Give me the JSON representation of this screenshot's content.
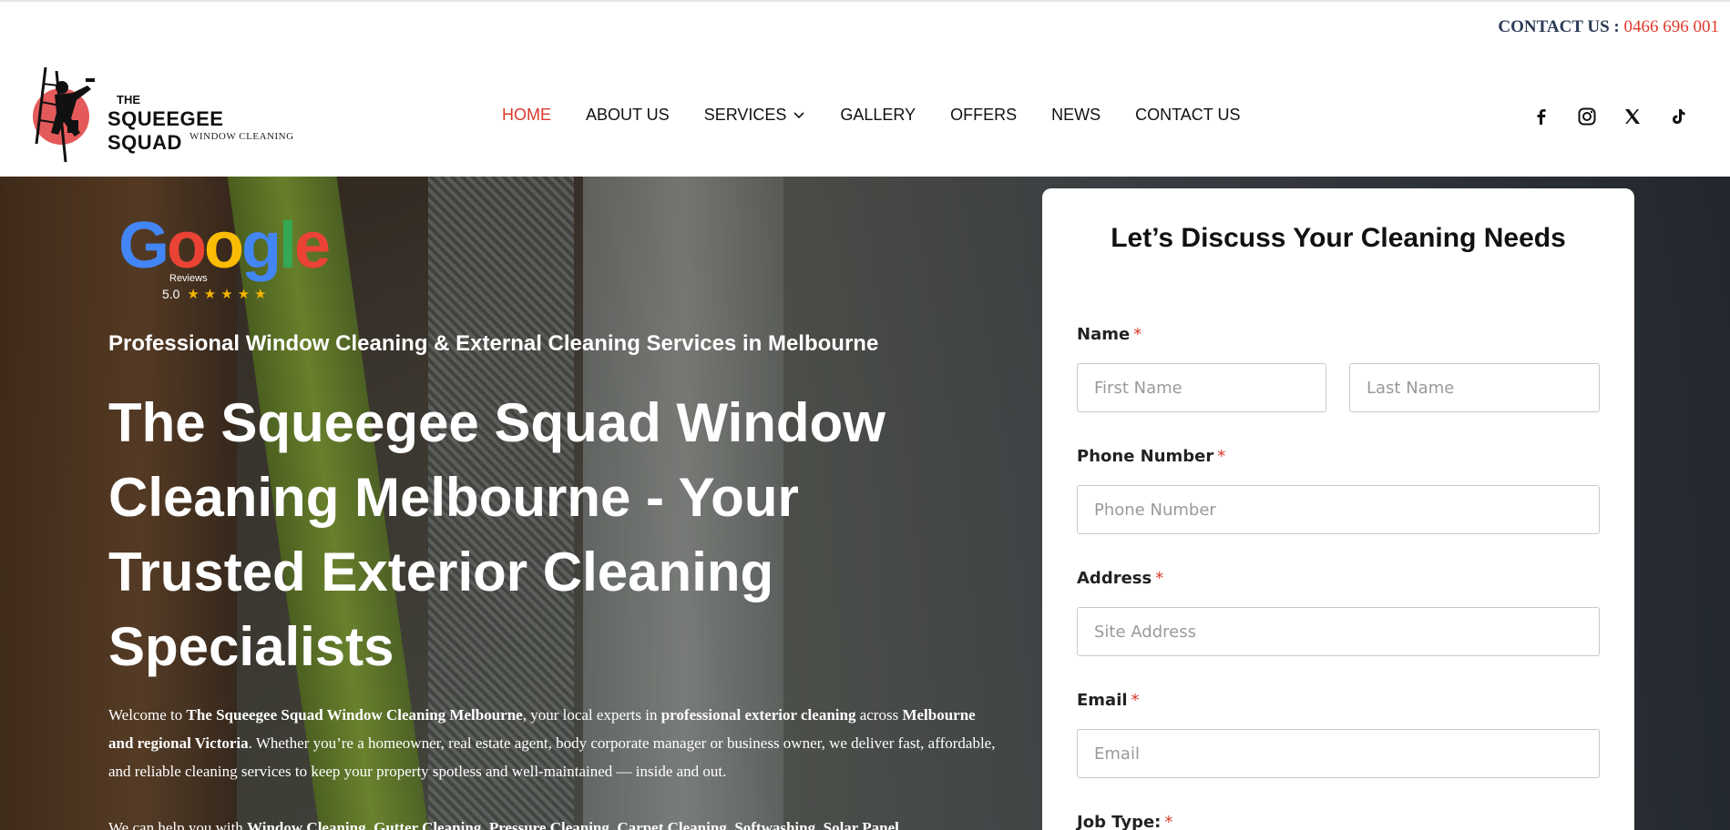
{
  "contact_bar": {
    "label": "CONTACT US :",
    "phone": "0466 696 001"
  },
  "logo": {
    "the": "THE",
    "brand": "SQUEEGEE SQUAD",
    "sub": "WINDOW CLEANING"
  },
  "nav": {
    "items": [
      {
        "label": "HOME",
        "active": true
      },
      {
        "label": "ABOUT US"
      },
      {
        "label": "SERVICES",
        "has_dropdown": true
      },
      {
        "label": "GALLERY"
      },
      {
        "label": "OFFERS"
      },
      {
        "label": "NEWS"
      },
      {
        "label": "CONTACT US"
      }
    ]
  },
  "social": [
    "facebook-icon",
    "instagram-icon",
    "x-icon",
    "tiktok-icon"
  ],
  "google": {
    "word": [
      "G",
      "o",
      "o",
      "g",
      "l",
      "e"
    ],
    "colors": [
      "#4285F4",
      "#EA4335",
      "#FBBC05",
      "#4285F4",
      "#34A853",
      "#EA4335"
    ],
    "reviews": "Reviews",
    "rating": "5.0",
    "stars": "★★★★★"
  },
  "hero": {
    "tagline": "Professional Window Cleaning & External Cleaning Services in Melbourne",
    "title": "The Squeegee Squad Window Cleaning Melbourne - Your Trusted Exterior Cleaning Specialists",
    "p1": {
      "a": "Welcome to ",
      "b": "The Squeegee Squad Window Cleaning Melbourne",
      "c": ", your local experts in ",
      "d": "professional exterior cleaning",
      "e": " across ",
      "f": "Melbourne and regional Victoria",
      "g": ". Whether you’re a homeowner, real estate agent, body corporate manager or business owner, we deliver fast, affordable, and reliable cleaning services to keep your property spotless and well-maintained — inside and out."
    },
    "p2": {
      "a": "We can help you with ",
      "b": "Window Cleaning",
      "c": ", ",
      "d": "Gutter Cleaning",
      "e": ", ",
      "f": "Pressure Cleaning",
      "g": ", ",
      "h": "Carpet Cleaning",
      "i": ", ",
      "j": "Softwashing",
      "k": ", ",
      "l": "Solar Panel"
    }
  },
  "form": {
    "title": "Let’s Discuss Your Cleaning Needs",
    "name_label": "Name",
    "first_placeholder": "First Name",
    "last_placeholder": "Last Name",
    "phone_label": "Phone Number",
    "phone_placeholder": "Phone Number",
    "address_label": "Address",
    "address_placeholder": "Site Address",
    "email_label": "Email",
    "email_placeholder": "Email",
    "jobtype_label": "Job Type:",
    "required_mark": "*"
  }
}
